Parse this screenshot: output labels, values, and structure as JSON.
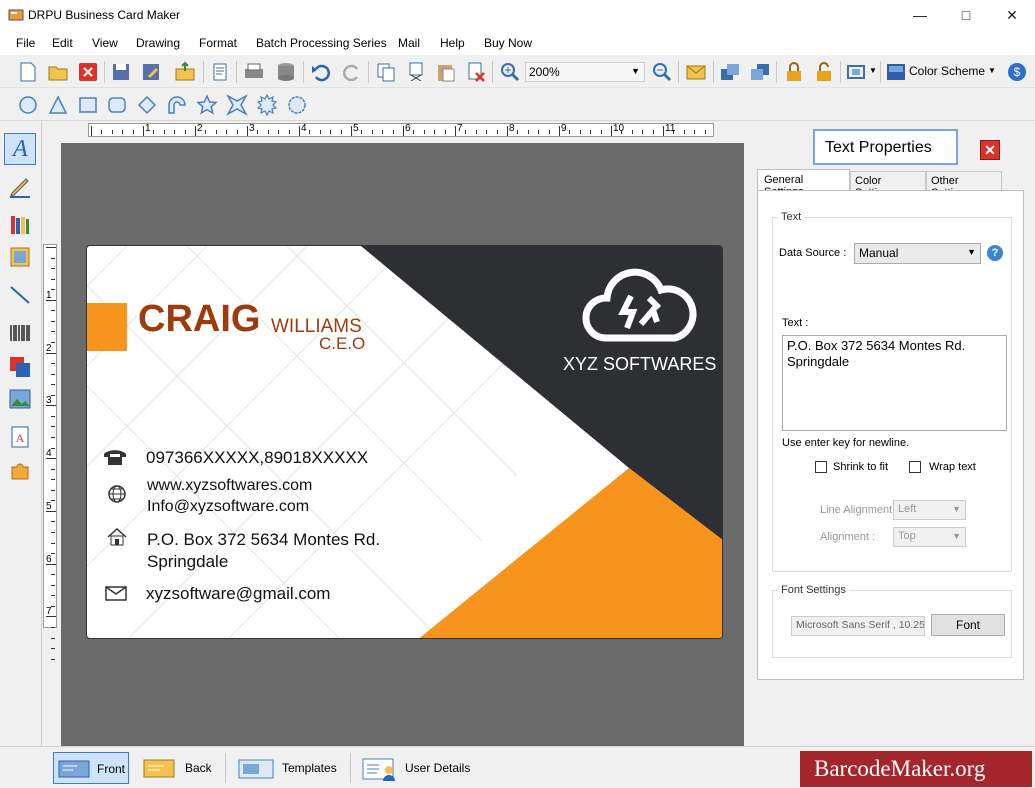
{
  "app": {
    "title": "DRPU Business Card Maker"
  },
  "menu": [
    "File",
    "Edit",
    "View",
    "Drawing",
    "Format",
    "Batch Processing Series",
    "Mail",
    "Help",
    "Buy Now"
  ],
  "toolbar": {
    "zoom": "200%",
    "color_scheme": "Color Scheme"
  },
  "card": {
    "first_name": "CRAIG",
    "last_name": "WILLIAMS",
    "designation": "C.E.O",
    "company": "XYZ SOFTWARES",
    "phone": "097366XXXXX,89018XXXXX",
    "web": "www.xyzsoftwares.com",
    "info_email": "Info@xyzsoftware.com",
    "address_line1": "P.O. Box 372 5634 Montes Rd.",
    "address_line2": "Springdale",
    "email": "xyzsoftware@gmail.com"
  },
  "ruler": {
    "h": [
      "1",
      "2",
      "3",
      "4",
      "5",
      "6",
      "7",
      "8",
      "9",
      "10",
      "11"
    ],
    "v": [
      "1",
      "2",
      "3",
      "4",
      "5",
      "6",
      "7"
    ]
  },
  "panel": {
    "title": "Text Properties",
    "tabs": [
      "General Settings",
      "Color Settings",
      "Other Settings"
    ],
    "text_group": "Text",
    "data_source_label": "Data Source :",
    "data_source": "Manual",
    "text_label": "Text :",
    "text_value": "P.O. Box 372 5634 Montes Rd.\nSpringdale",
    "hint": "Use enter key for newline.",
    "shrink": "Shrink to fit",
    "wrap": "Wrap text",
    "line_align_label": "Line Alignment",
    "line_align": "Left",
    "align_label": "Alignment :",
    "align": "Top",
    "font_group": "Font Settings",
    "font_value": "Microsoft Sans Serif , 10.25",
    "font_button": "Font"
  },
  "bottom": {
    "front": "Front",
    "back": "Back",
    "templates": "Templates",
    "user_details": "User Details",
    "brand": "BarcodeMaker.org"
  },
  "colors": {
    "orange": "#f7941d",
    "dark": "#2d2f33",
    "name": "#9e3b0c",
    "brand_bg": "#a4262c"
  }
}
